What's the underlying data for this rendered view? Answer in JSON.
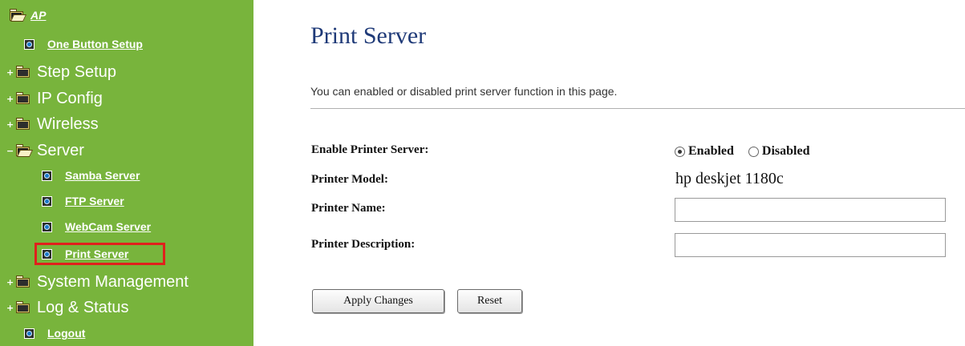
{
  "sidebar": {
    "root_label": "AP",
    "items": [
      {
        "label": "One Button Setup",
        "type": "page",
        "level": 1
      },
      {
        "label": "Step Setup",
        "type": "folder",
        "level": 1,
        "expanded": false
      },
      {
        "label": "IP Config",
        "type": "folder",
        "level": 1,
        "expanded": false
      },
      {
        "label": "Wireless",
        "type": "folder",
        "level": 1,
        "expanded": false
      },
      {
        "label": "Server",
        "type": "folder",
        "level": 1,
        "expanded": true
      },
      {
        "label": "Samba Server",
        "type": "page",
        "level": 2
      },
      {
        "label": "FTP Server",
        "type": "page",
        "level": 2
      },
      {
        "label": "WebCam Server",
        "type": "page",
        "level": 2
      },
      {
        "label": "Print Server",
        "type": "page",
        "level": 2,
        "highlighted": true
      },
      {
        "label": "System Management",
        "type": "folder",
        "level": 1,
        "expanded": false
      },
      {
        "label": "Log & Status",
        "type": "folder",
        "level": 1,
        "expanded": false
      },
      {
        "label": "Logout",
        "type": "page",
        "level": 1
      }
    ],
    "expand_symbol": "+",
    "collapse_symbol": "−",
    "bg_color": "#78b43c",
    "highlight_color": "#e0201c"
  },
  "main": {
    "title": "Print Server",
    "description": "You can enabled or disabled print server function in this page.",
    "fields": {
      "enable_label": "Enable Printer Server:",
      "model_label": "Printer Model:",
      "name_label": "Printer Name:",
      "description_label": "Printer Description:"
    },
    "enable_options": {
      "enabled": "Enabled",
      "disabled": "Disabled",
      "selected": "Enabled"
    },
    "model_value": "hp deskjet 1180c",
    "name_value": "",
    "description_value": "",
    "buttons": {
      "apply": "Apply Changes",
      "reset": "Reset"
    },
    "title_color": "#1f3a78"
  }
}
